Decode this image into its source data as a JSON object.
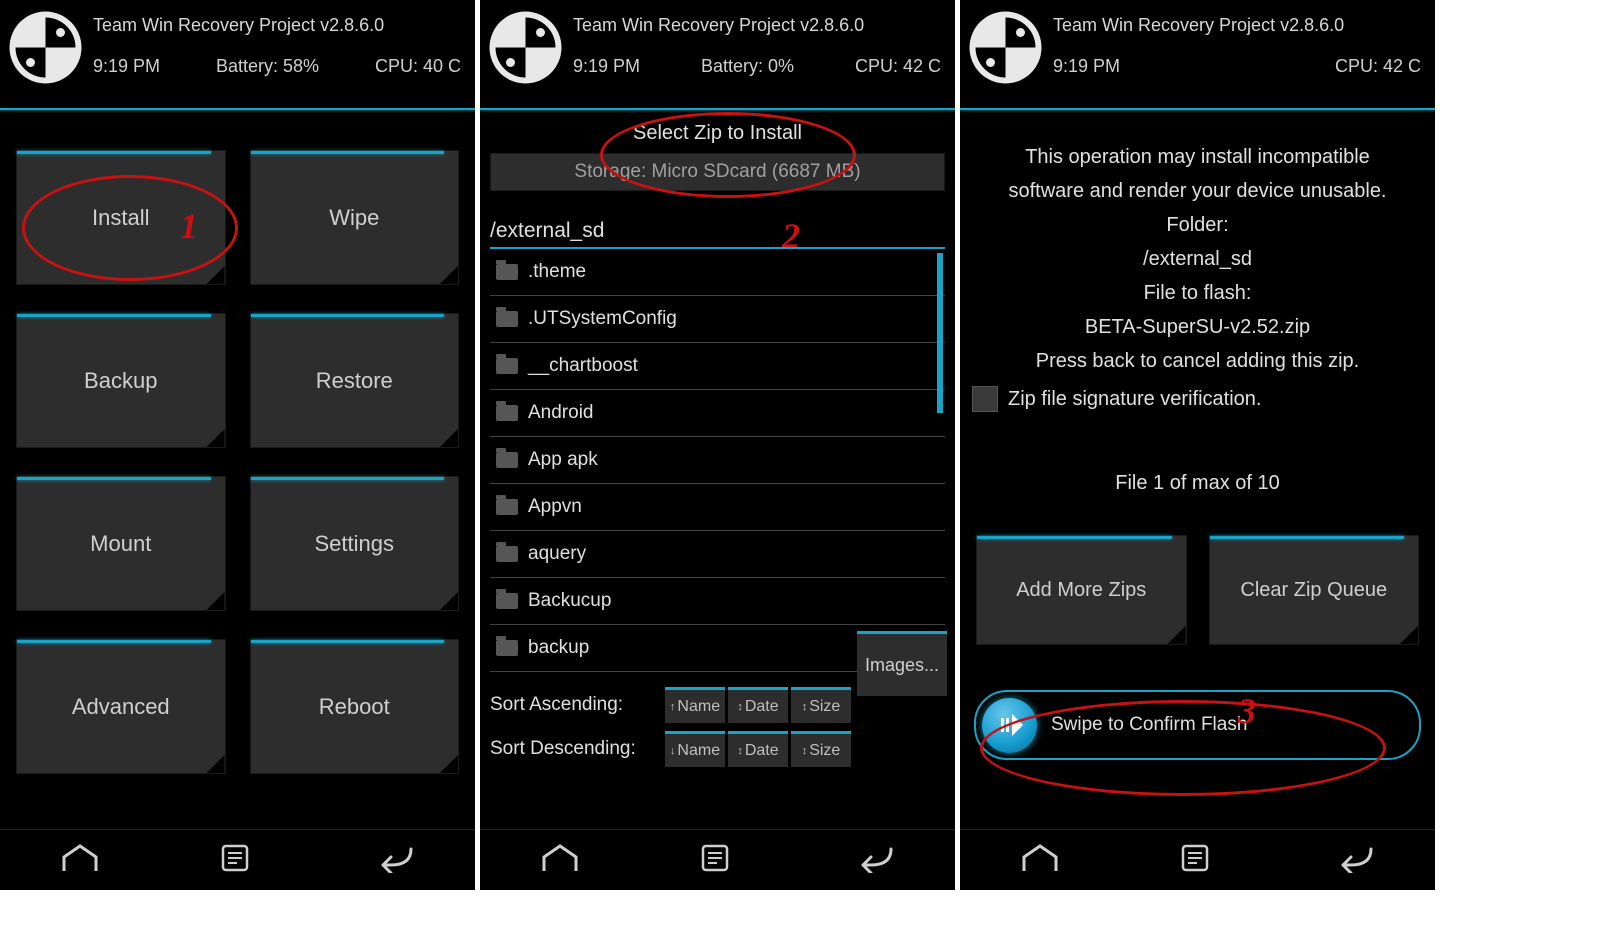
{
  "screens": [
    {
      "title": "Team Win Recovery Project  v2.8.6.0",
      "time": "9:19 PM",
      "battery": "Battery: 58%",
      "cpu": "CPU: 40 C",
      "tiles": [
        "Install",
        "Wipe",
        "Backup",
        "Restore",
        "Mount",
        "Settings",
        "Advanced",
        "Reboot"
      ],
      "annotation_num": "1"
    },
    {
      "title": "Team Win Recovery Project  v2.8.6.0",
      "time": "9:19 PM",
      "battery": "Battery: 0%",
      "cpu": "CPU: 42 C",
      "subheader": "Select Zip to Install",
      "storage": "Storage: Micro SDcard (6687 MB)",
      "path": "/external_sd",
      "files": [
        ".theme",
        ".UTSystemConfig",
        "__chartboost",
        "Android",
        "App apk",
        "Appvn",
        "aquery",
        "Backucup",
        "backup"
      ],
      "sort_asc_label": "Sort Ascending:",
      "sort_desc_label": "Sort Descending:",
      "sort_buttons": [
        "Name",
        "Date",
        "Size"
      ],
      "images_label": "Images...",
      "annotation_num": "2"
    },
    {
      "title": "Team Win Recovery Project  v2.8.6.0",
      "time": "9:19 PM",
      "battery": "",
      "cpu": "CPU: 42 C",
      "warn_line1": "This operation may install incompatible",
      "warn_line2": "software and render your device unusable.",
      "folder_label": "Folder:",
      "folder_value": "/external_sd",
      "file_label": "File to flash:",
      "file_value": "BETA-SuperSU-v2.52.zip",
      "cancel_hint": "Press back to cancel adding this zip.",
      "sig_verify": "Zip file signature verification.",
      "file_count": "File 1 of max of 10",
      "add_more": "Add More Zips",
      "clear_queue": "Clear Zip Queue",
      "swipe_label": "Swipe to Confirm Flash",
      "annotation_num": "3"
    }
  ]
}
